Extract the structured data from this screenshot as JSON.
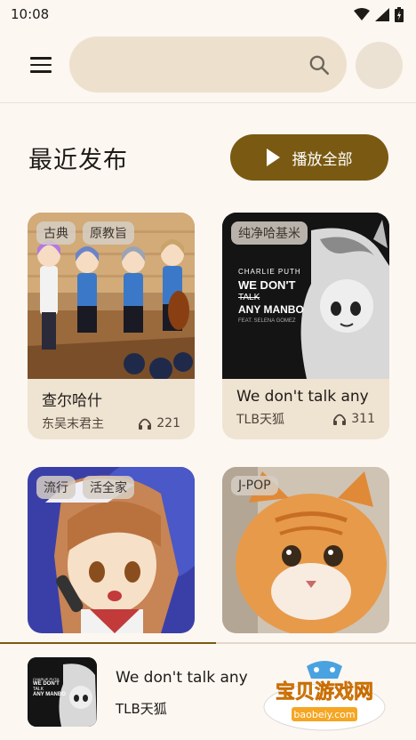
{
  "status_bar": {
    "time": "10:08"
  },
  "search": {
    "placeholder": ""
  },
  "section": {
    "title": "最近发布",
    "play_all_label": "播放全部"
  },
  "cards": [
    {
      "tags": [
        "古典",
        "原教旨"
      ],
      "title": "查尔哈什",
      "artist": "东吴末君主",
      "plays": "221"
    },
    {
      "tags": [
        "纯净哈基米"
      ],
      "title": "We don't talk any",
      "artist": "TLB天狐",
      "plays": "311",
      "cover_text": [
        "CHARLIE PUTH",
        "WE DON'T",
        "TALK",
        "ANY MANBO",
        "FEAT. SELENA GOMEZ"
      ]
    },
    {
      "tags": [
        "流行",
        "活全家"
      ],
      "title": "",
      "artist": "",
      "plays": ""
    },
    {
      "tags": [
        "J-POP"
      ],
      "title": "",
      "artist": "",
      "plays": ""
    }
  ],
  "player": {
    "title": "We don't talk any",
    "artist": "TLB天狐",
    "progress": 0.52,
    "cover_text": [
      "CHARLIE PUTH",
      "WE DON'T",
      "TALK",
      "ANY MANBO"
    ]
  },
  "watermark": {
    "name": "宝贝游戏网",
    "url": "baobeiy.com"
  },
  "colors": {
    "accent": "#7a5a12",
    "background": "#fdf7f2",
    "search": "#ede1ce",
    "card": "#efe3d2"
  }
}
